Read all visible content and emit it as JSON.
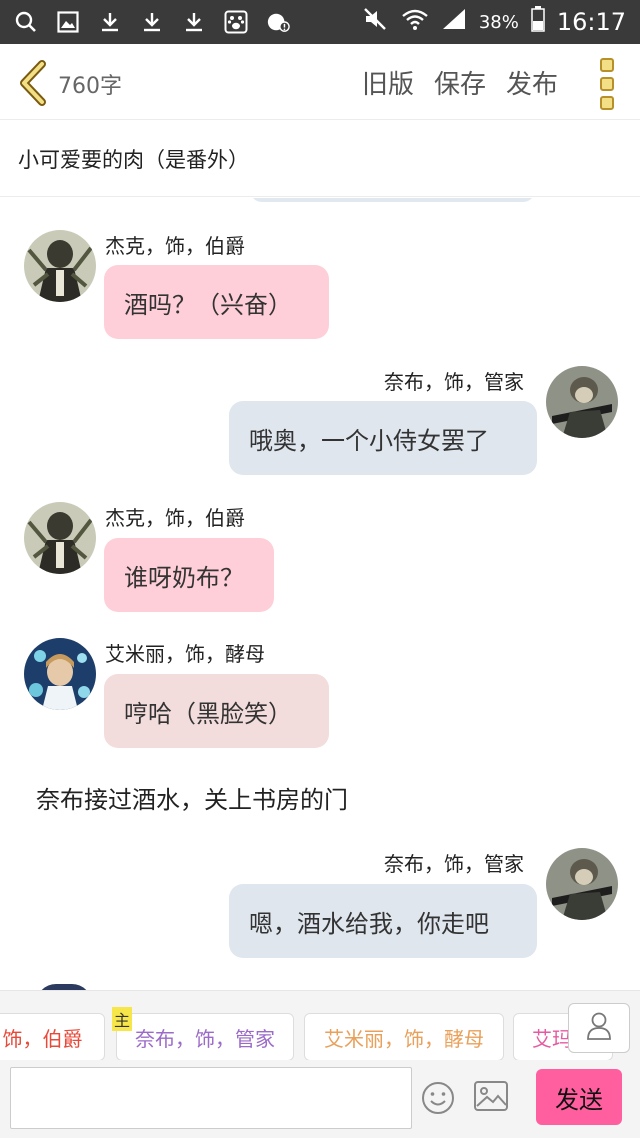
{
  "status_bar": {
    "icons": [
      "search-icon",
      "gallery-icon",
      "download-icon",
      "download-icon",
      "download-icon",
      "baidu-paw-icon",
      "game-alert-icon"
    ],
    "battery_percent": "38%",
    "time": "16:17"
  },
  "toolbar": {
    "word_count": "760字",
    "old_version": "旧版",
    "save": "保存",
    "publish": "发布"
  },
  "title": "小可爱要的肉（是番外）",
  "messages": [
    {
      "speaker": "杰克，饰，伯爵",
      "text": "酒吗？（兴奋）"
    },
    {
      "speaker": "奈布，饰，管家",
      "text": "哦奥，一个小侍女罢了"
    },
    {
      "speaker": "杰克，饰，伯爵",
      "text": "谁呀奶布？"
    },
    {
      "speaker": "艾米丽，饰，酵母",
      "text": "哼哈（黑脸笑）"
    },
    {
      "narration": "奈布接过酒水，关上书房的门"
    },
    {
      "speaker": "奈布，饰，管家",
      "text": "嗯，酒水给我，你走吧"
    }
  ],
  "character_bar": {
    "chips": [
      "饰，伯爵",
      "奈布，饰，管家",
      "艾米丽，饰，酵母",
      "艾玛"
    ],
    "host_tag": "主"
  },
  "input": {
    "placeholder": "",
    "send": "发送"
  },
  "colors": {
    "accent_pink": "#ff5f9f",
    "bubble_pink": "#ffcfd9",
    "bubble_blue": "#dfe6ee",
    "bubble_rose": "#f3dcdc"
  }
}
